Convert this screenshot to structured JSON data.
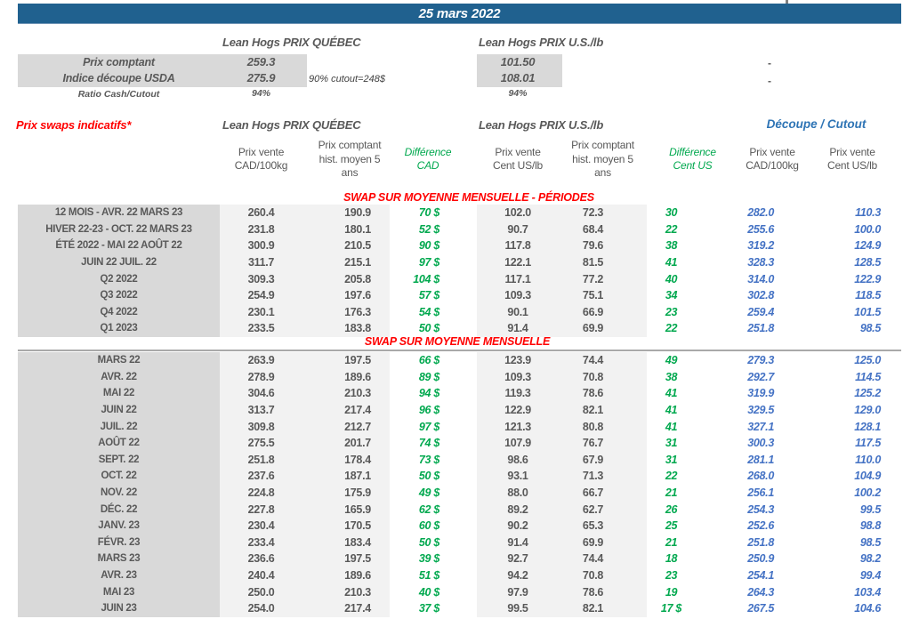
{
  "banner": {
    "date": "25 mars 2022"
  },
  "spot": {
    "quebec_header": "Lean Hogs PRIX QUÉBEC",
    "us_header": "Lean Hogs PRIX U.S./lb",
    "rows": [
      {
        "label": "Prix comptant",
        "qc": "259.3",
        "us": "101.50",
        "right": "-"
      },
      {
        "label": "Indice découpe USDA",
        "qc": "275.9",
        "note": "90% cutout=248$",
        "us": "108.01",
        "right": "-"
      },
      {
        "label": "Ratio Cash/Cutout",
        "qc": "94%",
        "us": "94%"
      }
    ]
  },
  "swaps": {
    "title": "Prix swaps indicatifs*",
    "quebec_header": "Lean Hogs PRIX QUÉBEC",
    "us_header": "Lean Hogs PRIX U.S./lb",
    "cutout_header": "Découpe / Cutout",
    "columns": [
      {
        "lines": [
          "Prix vente",
          "CAD/100kg"
        ],
        "color": "dark"
      },
      {
        "lines": [
          "Prix comptant",
          "hist. moyen 5",
          "ans"
        ],
        "color": "dark"
      },
      {
        "lines": [
          "Différence",
          "CAD"
        ],
        "color": "green"
      },
      {
        "lines": [
          "Prix vente",
          "Cent US/lb"
        ],
        "color": "dark"
      },
      {
        "lines": [
          "Prix comptant",
          "hist. moyen 5",
          "ans"
        ],
        "color": "dark"
      },
      {
        "lines": [
          "Différence",
          "Cent US"
        ],
        "color": "green"
      },
      {
        "lines": [
          "Prix vente",
          "CAD/100kg"
        ],
        "color": "dark"
      },
      {
        "lines": [
          "Prix vente",
          "Cent US/lb"
        ],
        "color": "dark"
      }
    ]
  },
  "periods": {
    "title": "SWAP SUR MOYENNE MENSUELLE - PÉRIODES",
    "rows": [
      {
        "label": "12 MOIS - AVR. 22 MARS 23",
        "values": [
          "260.4",
          "190.9",
          "70 $",
          "102.0",
          "72.3",
          "30",
          "282.0",
          "110.3"
        ]
      },
      {
        "label": "HIVER 22-23 - OCT. 22 MARS 23",
        "values": [
          "231.8",
          "180.1",
          "52 $",
          "90.7",
          "68.4",
          "22",
          "255.6",
          "100.0"
        ]
      },
      {
        "label": "ÉTÉ 2022 - MAI 22 AOÛT 22",
        "values": [
          "300.9",
          "210.5",
          "90 $",
          "117.8",
          "79.6",
          "38",
          "319.2",
          "124.9"
        ]
      },
      {
        "label": "JUIN 22 JUIL. 22",
        "values": [
          "311.7",
          "215.1",
          "97 $",
          "122.1",
          "81.5",
          "41",
          "328.3",
          "128.5"
        ]
      },
      {
        "label": "Q2 2022",
        "values": [
          "309.3",
          "205.8",
          "104 $",
          "117.1",
          "77.2",
          "40",
          "314.0",
          "122.9"
        ]
      },
      {
        "label": "Q3 2022",
        "values": [
          "254.9",
          "197.6",
          "57 $",
          "109.3",
          "75.1",
          "34",
          "302.8",
          "118.5"
        ]
      },
      {
        "label": "Q4 2022",
        "values": [
          "230.1",
          "176.3",
          "54 $",
          "90.1",
          "66.9",
          "23",
          "259.4",
          "101.5"
        ]
      },
      {
        "label": "Q1 2023",
        "values": [
          "233.5",
          "183.8",
          "50 $",
          "91.4",
          "69.9",
          "22",
          "251.8",
          "98.5"
        ]
      }
    ]
  },
  "monthly": {
    "title": "SWAP SUR MOYENNE MENSUELLE",
    "rows": [
      {
        "label": "MARS 22",
        "values": [
          "263.9",
          "197.5",
          "66 $",
          "123.9",
          "74.4",
          "49",
          "279.3",
          "125.0"
        ]
      },
      {
        "label": "AVR. 22",
        "values": [
          "278.9",
          "189.6",
          "89 $",
          "109.3",
          "70.8",
          "38",
          "292.7",
          "114.5"
        ]
      },
      {
        "label": "MAI 22",
        "values": [
          "304.6",
          "210.3",
          "94 $",
          "119.3",
          "78.6",
          "41",
          "319.9",
          "125.2"
        ]
      },
      {
        "label": "JUIN 22",
        "values": [
          "313.7",
          "217.4",
          "96 $",
          "122.9",
          "82.1",
          "41",
          "329.5",
          "129.0"
        ]
      },
      {
        "label": "JUIL. 22",
        "values": [
          "309.8",
          "212.7",
          "97 $",
          "121.3",
          "80.8",
          "41",
          "327.1",
          "128.1"
        ]
      },
      {
        "label": "AOÛT 22",
        "values": [
          "275.5",
          "201.7",
          "74 $",
          "107.9",
          "76.7",
          "31",
          "300.3",
          "117.5"
        ]
      },
      {
        "label": "SEPT. 22",
        "values": [
          "251.8",
          "178.4",
          "73 $",
          "98.6",
          "67.9",
          "31",
          "281.1",
          "110.0"
        ]
      },
      {
        "label": "OCT. 22",
        "values": [
          "237.6",
          "187.1",
          "50 $",
          "93.1",
          "71.3",
          "22",
          "268.0",
          "104.9"
        ]
      },
      {
        "label": "NOV. 22",
        "values": [
          "224.8",
          "175.9",
          "49 $",
          "88.0",
          "66.7",
          "21",
          "256.1",
          "100.2"
        ]
      },
      {
        "label": "DÉC. 22",
        "values": [
          "227.8",
          "165.9",
          "62 $",
          "89.2",
          "62.7",
          "26",
          "254.3",
          "99.5"
        ]
      },
      {
        "label": "JANV. 23",
        "values": [
          "230.4",
          "170.5",
          "60 $",
          "90.2",
          "65.3",
          "25",
          "252.6",
          "98.8"
        ]
      },
      {
        "label": "FÉVR. 23",
        "values": [
          "233.4",
          "183.4",
          "50 $",
          "91.4",
          "69.9",
          "21",
          "251.8",
          "98.5"
        ]
      },
      {
        "label": "MARS 23",
        "values": [
          "236.6",
          "197.5",
          "39 $",
          "92.7",
          "74.4",
          "18",
          "250.9",
          "98.2"
        ]
      },
      {
        "label": "AVR. 23",
        "values": [
          "240.4",
          "189.6",
          "51 $",
          "94.2",
          "70.8",
          "23",
          "254.1",
          "99.4"
        ]
      },
      {
        "label": "MAI 23",
        "values": [
          "250.0",
          "210.3",
          "40 $",
          "97.9",
          "78.6",
          "19",
          "264.3",
          "103.4"
        ]
      },
      {
        "label": "JUIN 23",
        "values": [
          "254.0",
          "217.4",
          "37 $",
          "99.5",
          "82.1",
          "17 $",
          "267.5",
          "104.6"
        ]
      }
    ]
  },
  "colors": {
    "banner_bg": "#20618F",
    "red_accent": "#FF0000",
    "green_accent": "#00A84E",
    "blue_values": "#4472C4",
    "blue_header": "#2E74B5",
    "label_bg": "#D9D9D9",
    "column_bg": "#F2F2F2",
    "text": "#595959"
  }
}
